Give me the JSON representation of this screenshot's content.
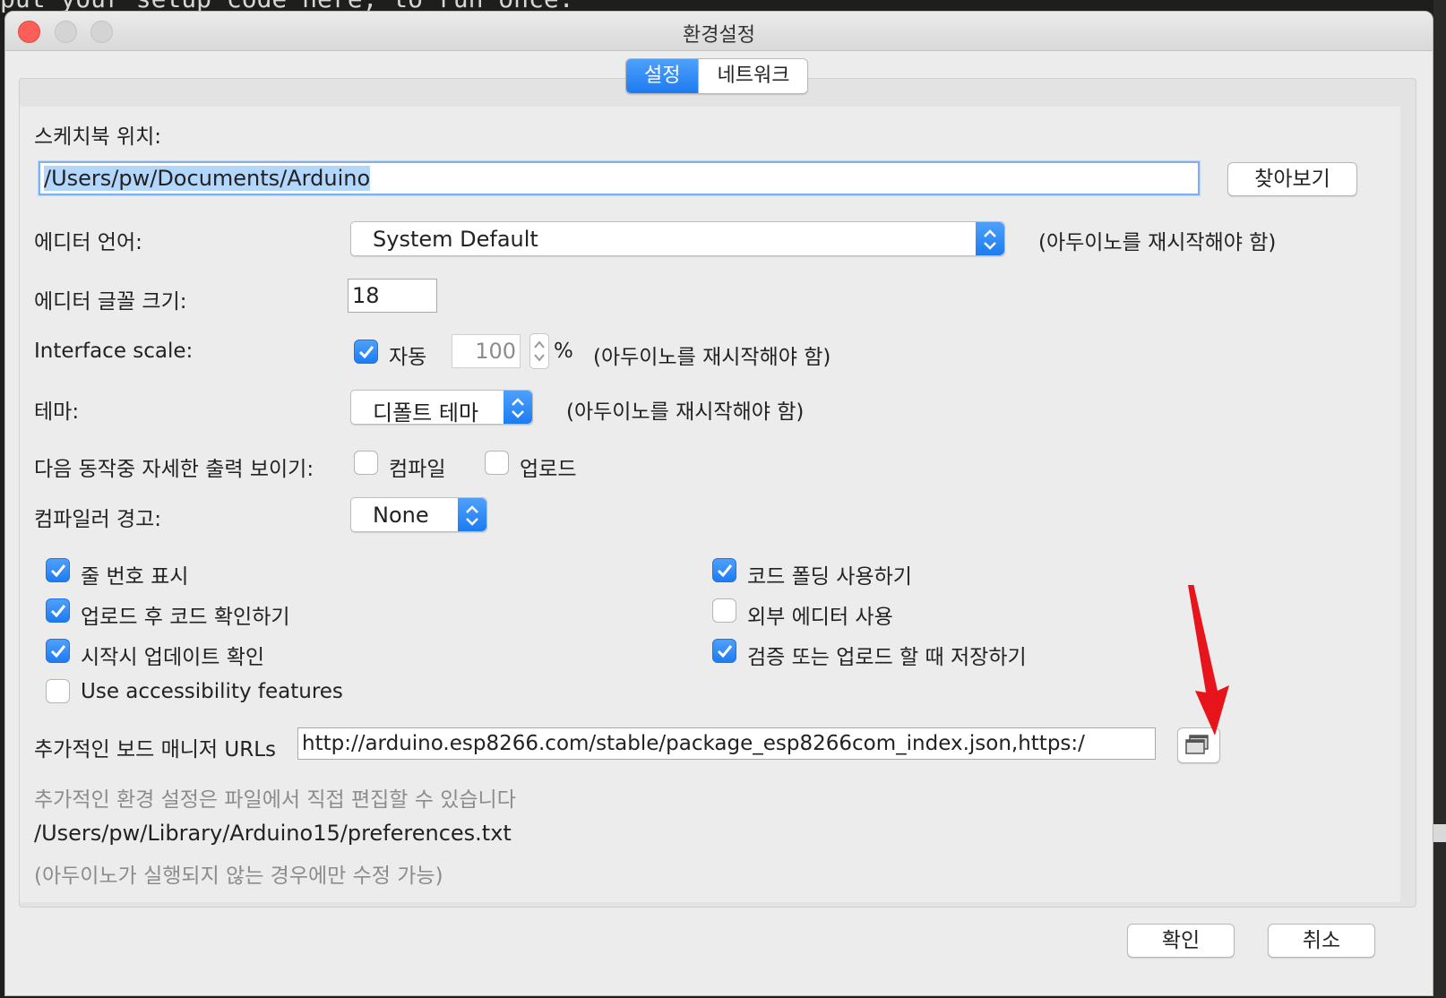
{
  "background": {
    "code_line": "put your setup code here, to run once:"
  },
  "window": {
    "title": "환경설정",
    "tabs": [
      {
        "label": "설정",
        "active": true
      },
      {
        "label": "네트워크",
        "active": false
      }
    ]
  },
  "settings": {
    "sketchbook_label": "스케치북 위치:",
    "sketchbook_path": "/Users/pw/Documents/Arduino",
    "browse_label": "찾아보기",
    "editor_language_label": "에디터 언어:",
    "editor_language_value": "System Default",
    "restart_note": "(아두이노를 재시작해야 함)",
    "font_size_label": "에디터 글꼴 크기:",
    "font_size_value": "18",
    "interface_scale_label": "Interface scale:",
    "auto_label": "자동",
    "scale_value": "100",
    "percent": "%",
    "theme_label": "테마:",
    "theme_value": "디폴트 테마",
    "verbose_label": "다음 동작중 자세한  출력 보이기:",
    "compile_label": "컴파일",
    "upload_label": "업로드",
    "compiler_warnings_label": "컴파일러 경고:",
    "compiler_warnings_value": "None",
    "options": [
      {
        "label": "줄 번호 표시",
        "checked": true
      },
      {
        "label": "업로드 후 코드 확인하기",
        "checked": true
      },
      {
        "label": "시작시 업데이트 확인",
        "checked": true
      },
      {
        "label": "Use accessibility features",
        "checked": false
      },
      {
        "label": "코드 폴딩 사용하기",
        "checked": true
      },
      {
        "label": "외부 에디터 사용",
        "checked": false
      },
      {
        "label": "검증 또는 업로드 할 때 저장하기",
        "checked": true
      }
    ],
    "board_urls_label": "추가적인 보드 매니저 URLs",
    "board_urls_value": "http://arduino.esp8266.com/stable/package_esp8266com_index.json,https:/",
    "more_prefs_note": "추가적인 환경 설정은 파일에서 직접 편집할 수 있습니다",
    "prefs_path": "/Users/pw/Library/Arduino15/preferences.txt",
    "edit_note": "(아두이노가 실행되지 않는 경우에만 수정 가능)"
  },
  "footer": {
    "ok_label": "확인",
    "cancel_label": "취소"
  },
  "colors": {
    "accent": "#1d7cf2",
    "annotation_arrow": "#e8141b"
  }
}
